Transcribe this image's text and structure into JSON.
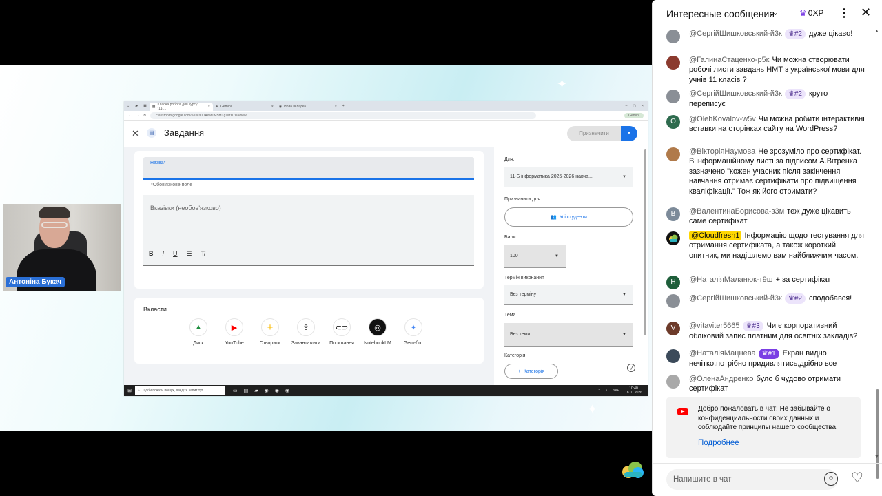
{
  "stage": {
    "presenter_name": "Антоніна Букач"
  },
  "browser": {
    "tabs": [
      "Класна робота для курсу \"11-...",
      "Gemini",
      "Нова вкладка"
    ],
    "url": "classroom.google.com/u/0/c/ODAxMTM5MTg1MzUz/a/new",
    "gemini_label": "Gemini"
  },
  "classroom": {
    "page_title": "Завдання",
    "assign_button": "Призначити",
    "title_label": "Назва*",
    "required_note": "*Обов'язкове поле",
    "description_placeholder": "Вказівки (необов'язково)",
    "format_buttons": [
      "B",
      "I",
      "U",
      "☰",
      "T̸"
    ],
    "attach_title": "Вкласти",
    "attachments": [
      {
        "label": "Диск",
        "icon": "drive-icon"
      },
      {
        "label": "YouTube",
        "icon": "youtube-icon"
      },
      {
        "label": "Створити",
        "icon": "plus-icon"
      },
      {
        "label": "Завантажити",
        "icon": "upload-icon"
      },
      {
        "label": "Посилання",
        "icon": "link-icon"
      },
      {
        "label": "NotebookLM",
        "icon": "notebooklm-icon"
      },
      {
        "label": "Gem-бот",
        "icon": "gem-icon"
      }
    ],
    "side": {
      "for_label": "Для:",
      "for_value": "11-Б інформатика 2025-2026 навча...",
      "assign_to_label": "Призначити для",
      "assign_to_value": "Усі студенти",
      "points_label": "Бали",
      "points_value": "100",
      "due_label": "Термін виконання",
      "due_value": "Без терміну",
      "topic_label": "Тема",
      "topic_value": "Без теми",
      "category_label": "Категорія",
      "category_button": "Категорія"
    }
  },
  "taskbar": {
    "search_placeholder": "Щоби почати пошук, введіть запит тут",
    "lang": "УКР",
    "time": "10:40",
    "date": "18.01.2026"
  },
  "chat": {
    "title": "Интересные сообщения",
    "xp": "0XP",
    "messages": [
      {
        "author": "@СергійШишковський-й3к",
        "badge": "#2",
        "badge_type": "b2",
        "text": "дуже цікаво!",
        "avatar_color": "#8a8f96",
        "avatar_letter": ""
      },
      {
        "author": "@ГалинаСтаценко-р5к",
        "badge": "",
        "badge_type": "",
        "text": "Чи можна створювати робочі листи завдань НМТ з української мови для учнів 11 класів ?",
        "avatar_color": "#8b3a2e",
        "avatar_letter": ""
      },
      {
        "author": "@СергійШишковський-й3к",
        "badge": "#2",
        "badge_type": "b2",
        "text": "круто переписує",
        "avatar_color": "#8a8f96",
        "avatar_letter": ""
      },
      {
        "author": "@OlehKovalov-w5v",
        "badge": "",
        "badge_type": "",
        "text": "Чи можна робити інтерактивні вставки на сторінках сайту на WordPress?",
        "avatar_color": "#2e6b4e",
        "avatar_letter": "O"
      },
      {
        "author": "@ВікторіяНаумова",
        "badge": "",
        "badge_type": "",
        "text": "Не зрозуміло про сертифікат. В інформаційному листі за підписом А.Вітренка зазначено \"кожен учасник після закінчення навчання отримає сертифікати про підвищення кваліфікації.\" Тож як його отримати?",
        "avatar_color": "#b07a4a",
        "avatar_letter": ""
      },
      {
        "author": "@ВалентинаБорисова-з3м",
        "badge": "",
        "badge_type": "",
        "text": "теж дуже цікавить саме сертифікат",
        "avatar_color": "#7c8a99",
        "avatar_letter": "B"
      },
      {
        "author": "@Cloudfresh1",
        "badge": "",
        "badge_type": "owner",
        "text": "Інформацію щодо тестування для отримання сертифіката, а також короткий опитник, ми надішлемо вам найближчим часом.",
        "avatar_color": "#111111",
        "avatar_letter": ""
      },
      {
        "author": "@НаталіяМаланюк-т9ш",
        "badge": "",
        "badge_type": "",
        "text": "+ за сертифікат",
        "avatar_color": "#1e5e3a",
        "avatar_letter": "H"
      },
      {
        "author": "@СергійШишковський-й3к",
        "badge": "#2",
        "badge_type": "b2",
        "text": "сподобався!",
        "avatar_color": "#8a8f96",
        "avatar_letter": ""
      },
      {
        "author": "@vitaviter5665",
        "badge": "#3",
        "badge_type": "b3",
        "text": "Чи є корпоративний обліковий запис платним для освітніх закладів?",
        "avatar_color": "#6d3b2a",
        "avatar_letter": "V"
      },
      {
        "author": "@НаталіяМацнева",
        "badge": "#1",
        "badge_type": "b1",
        "text": "Екран видно нечітко,потрібно придивлятись,дрібно все",
        "avatar_color": "#3b4a5a",
        "avatar_letter": ""
      },
      {
        "author": "@ОленаАндренко",
        "badge": "",
        "badge_type": "",
        "text": "було б чудово отримати сертифікат",
        "avatar_color": "#a9a9a9",
        "avatar_letter": ""
      }
    ],
    "welcome_text": "Добро пожаловать в чат! Не забывайте о конфиденциальности своих данных и соблюдайте принципы нашего сообщества.",
    "welcome_link": "Подробнее",
    "input_placeholder": "Напишите в чат"
  }
}
